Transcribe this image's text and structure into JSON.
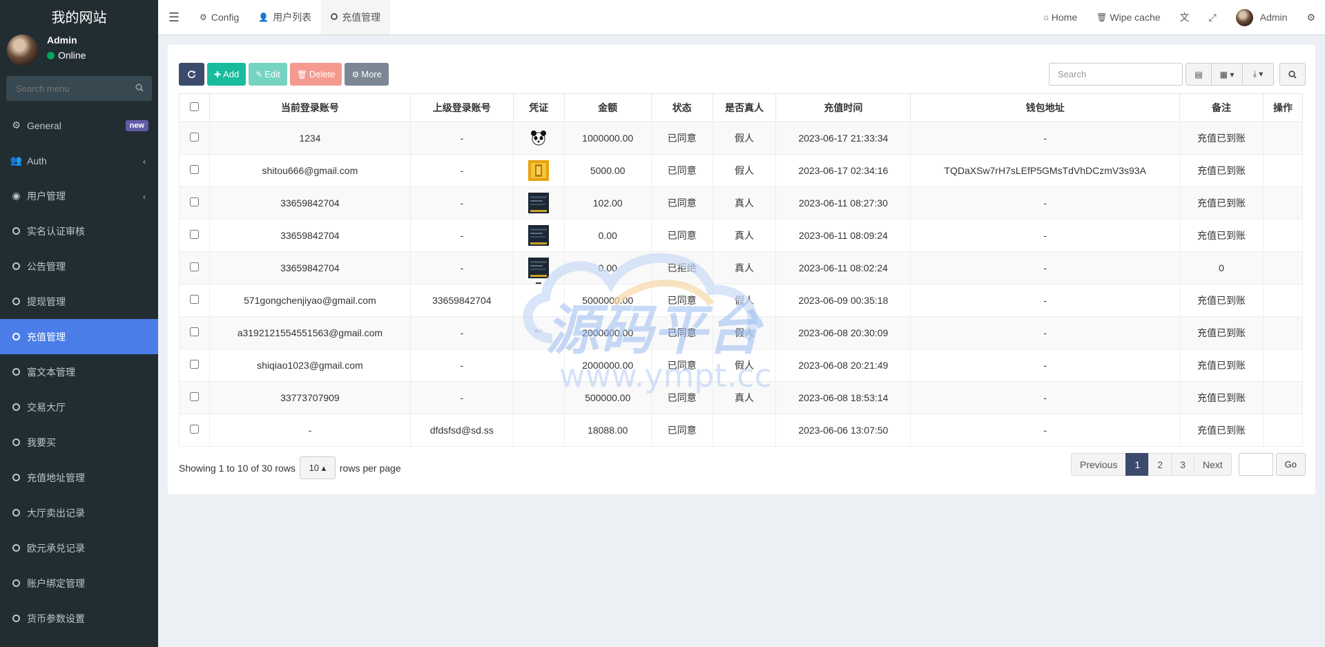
{
  "sidebar": {
    "title": "我的网站",
    "user": {
      "name": "Admin",
      "status": "Online"
    },
    "search_placeholder": "Search menu",
    "items": [
      {
        "label": "General",
        "icon": "cogs-icon",
        "badge": "new"
      },
      {
        "label": "Auth",
        "icon": "users-icon",
        "chevron": "‹"
      },
      {
        "label": "用户管理",
        "icon": "user-circle-icon",
        "chevron": "‹"
      },
      {
        "label": "实名认证审核",
        "icon": "circle-icon"
      },
      {
        "label": "公告管理",
        "icon": "circle-icon"
      },
      {
        "label": "提现管理",
        "icon": "circle-icon"
      },
      {
        "label": "充值管理",
        "icon": "circle-icon",
        "active": true
      },
      {
        "label": "富文本管理",
        "icon": "circle-icon"
      },
      {
        "label": "交易大厅",
        "icon": "circle-icon"
      },
      {
        "label": "我要买",
        "icon": "circle-icon"
      },
      {
        "label": "充值地址管理",
        "icon": "circle-icon"
      },
      {
        "label": "大厅卖出记录",
        "icon": "circle-icon"
      },
      {
        "label": "欧元承兑记录",
        "icon": "circle-icon"
      },
      {
        "label": "账户绑定管理",
        "icon": "circle-icon"
      },
      {
        "label": "货币参数设置",
        "icon": "circle-icon"
      }
    ]
  },
  "header": {
    "tabs": [
      {
        "label": "Config",
        "icon": "gear-icon"
      },
      {
        "label": "用户列表",
        "icon": "user-icon"
      },
      {
        "label": "充值管理",
        "icon": "circle-icon",
        "active": true
      }
    ],
    "right": {
      "home": "Home",
      "wipe": "Wipe cache",
      "admin": "Admin"
    }
  },
  "toolbar": {
    "add": "Add",
    "edit": "Edit",
    "delete": "Delete",
    "more": "More",
    "search_placeholder": "Search"
  },
  "table": {
    "columns": [
      "",
      "当前登录账号",
      "上级登录账号",
      "凭证",
      "金额",
      "状态",
      "是否真人",
      "充值时间",
      "钱包地址",
      "备注",
      "操作"
    ],
    "rows": [
      {
        "account": "1234",
        "parent": "-",
        "proof": "panda",
        "amount": "1000000.00",
        "status": "已同意",
        "status_type": "ok",
        "real": "假人",
        "real_type": "fake",
        "time": "2023-06-17 21:33:34",
        "wallet": "-",
        "remark": "充值已到账"
      },
      {
        "account": "shitou666@gmail.com",
        "parent": "-",
        "proof": "gold",
        "amount": "5000.00",
        "status": "已同意",
        "status_type": "ok",
        "real": "假人",
        "real_type": "fake",
        "time": "2023-06-17 02:34:16",
        "wallet": "TQDaXSw7rH7sLEfP5GMsTdVhDCzmV3s93A",
        "remark": "充值已到账"
      },
      {
        "account": "33659842704",
        "parent": "-",
        "proof": "dark",
        "amount": "102.00",
        "status": "已同意",
        "status_type": "ok",
        "real": "真人",
        "real_type": "real",
        "time": "2023-06-11 08:27:30",
        "wallet": "-",
        "remark": "充值已到账"
      },
      {
        "account": "33659842704",
        "parent": "-",
        "proof": "dark",
        "amount": "0.00",
        "status": "已同意",
        "status_type": "ok",
        "real": "真人",
        "real_type": "real",
        "time": "2023-06-11 08:09:24",
        "wallet": "-",
        "remark": "充值已到账"
      },
      {
        "account": "33659842704",
        "parent": "-",
        "proof": "dark",
        "amount": "0.00",
        "status": "已拒绝",
        "status_type": "no",
        "real": "真人",
        "real_type": "real",
        "time": "2023-06-11 08:02:24",
        "wallet": "-",
        "remark": "0"
      },
      {
        "account": "571gongchenjiyao@gmail.com",
        "parent": "33659842704",
        "proof": "thin",
        "amount": "5000000.00",
        "status": "已同意",
        "status_type": "ok",
        "real": "假人",
        "real_type": "fake",
        "time": "2023-06-09 00:35:18",
        "wallet": "-",
        "remark": "充值已到账"
      },
      {
        "account": "a3192121554551563@gmail.com",
        "parent": "-",
        "proof": "small",
        "amount": "2000000.00",
        "status": "已同意",
        "status_type": "ok",
        "real": "假人",
        "real_type": "fake",
        "time": "2023-06-08 20:30:09",
        "wallet": "-",
        "remark": "充值已到账"
      },
      {
        "account": "shiqiao1023@gmail.com",
        "parent": "-",
        "proof": "",
        "amount": "2000000.00",
        "status": "已同意",
        "status_type": "ok",
        "real": "假人",
        "real_type": "fake",
        "time": "2023-06-08 20:21:49",
        "wallet": "-",
        "remark": "充值已到账"
      },
      {
        "account": "33773707909",
        "parent": "-",
        "proof": "",
        "amount": "500000.00",
        "status": "已同意",
        "status_type": "ok",
        "real": "真人",
        "real_type": "real",
        "time": "2023-06-08 18:53:14",
        "wallet": "-",
        "remark": "充值已到账"
      },
      {
        "account": "-",
        "parent": "dfdsfsd@sd.ss",
        "proof": "",
        "amount": "18088.00",
        "status": "已同意",
        "status_type": "ok",
        "real": "",
        "real_type": "real",
        "time": "2023-06-06 13:07:50",
        "wallet": "-",
        "remark": "充值已到账"
      }
    ]
  },
  "footer": {
    "showing": "Showing 1 to 10 of 30 rows",
    "rows_per_page_value": "10",
    "rows_per_page_suffix": "rows per page",
    "pages": [
      "Previous",
      "1",
      "2",
      "3",
      "Next"
    ],
    "current_page": "1",
    "go": "Go"
  },
  "watermark": {
    "text_cn": "源码平台",
    "text_url": "www.ympt.cc"
  },
  "colors": {
    "sidebar": "#222d32",
    "active": "#4a7de8",
    "ok": "#18bc9c",
    "danger": "#f75444"
  }
}
